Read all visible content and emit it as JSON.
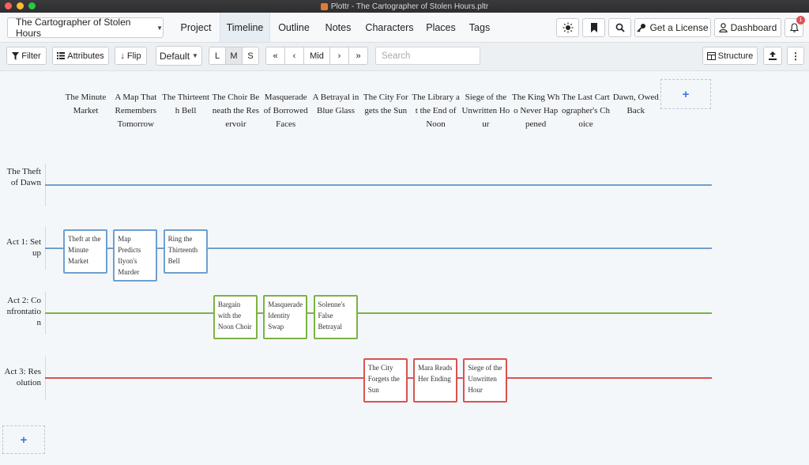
{
  "window": {
    "title": "Plottr - The Cartographer of Stolen Hours.pltr"
  },
  "nav": {
    "project_selector": "The Cartographer of Stolen Hours",
    "tabs": [
      "Project",
      "Timeline",
      "Outline",
      "Notes",
      "Characters",
      "Places",
      "Tags"
    ],
    "active_tab": "Timeline",
    "get_license": "Get a License",
    "dashboard": "Dashboard",
    "notification_count": "1"
  },
  "toolbar": {
    "filter": "Filter",
    "attributes": "Attributes",
    "flip": "Flip",
    "view_select": "Default",
    "size_l": "L",
    "size_m": "M",
    "size_s": "S",
    "size_selected": "M",
    "mid": "Mid",
    "search_placeholder": "Search",
    "structure": "Structure"
  },
  "timeline": {
    "chapters": [
      "The Minute Market",
      "A Map That Remembers Tomorrow",
      "The Thirteenth Bell",
      "The Choir Beneath the Reservoir",
      "Masquerade of Borrowed Faces",
      "A Betrayal in Blue Glass",
      "The City Forgets the Sun",
      "The Library at the End of Noon",
      "Siege of the Unwritten Hour",
      "The King Who Never Happened",
      "The Last Cartographer's Choice",
      "Dawn, Owed Back"
    ],
    "plotlines": [
      {
        "title": "The Theft of Dawn",
        "color": "#6f9fcf",
        "cards": []
      },
      {
        "title": "Act 1: Setup",
        "color": "#6f9fcf",
        "cards": [
          {
            "chapter": 0,
            "title": "Theft at the Minute Market"
          },
          {
            "chapter": 1,
            "title": "Map Predicts Ilyon's Murder"
          },
          {
            "chapter": 2,
            "title": "Ring the Thirteenth Bell"
          }
        ]
      },
      {
        "title": "Act 2: Confrontation",
        "color": "#7cb342",
        "cards": [
          {
            "chapter": 3,
            "title": "Bargain with the Noon Choir"
          },
          {
            "chapter": 4,
            "title": "Masquerade Identity Swap"
          },
          {
            "chapter": 5,
            "title": "Solenne's False Betrayal"
          }
        ]
      },
      {
        "title": "Act 3: Resolution",
        "color": "#d9534f",
        "cards": [
          {
            "chapter": 6,
            "title": "The City Forgets the Sun"
          },
          {
            "chapter": 7,
            "title": "Mara Reads Her Ending"
          },
          {
            "chapter": 8,
            "title": "Siege of the Unwritten Hour"
          }
        ]
      }
    ]
  }
}
